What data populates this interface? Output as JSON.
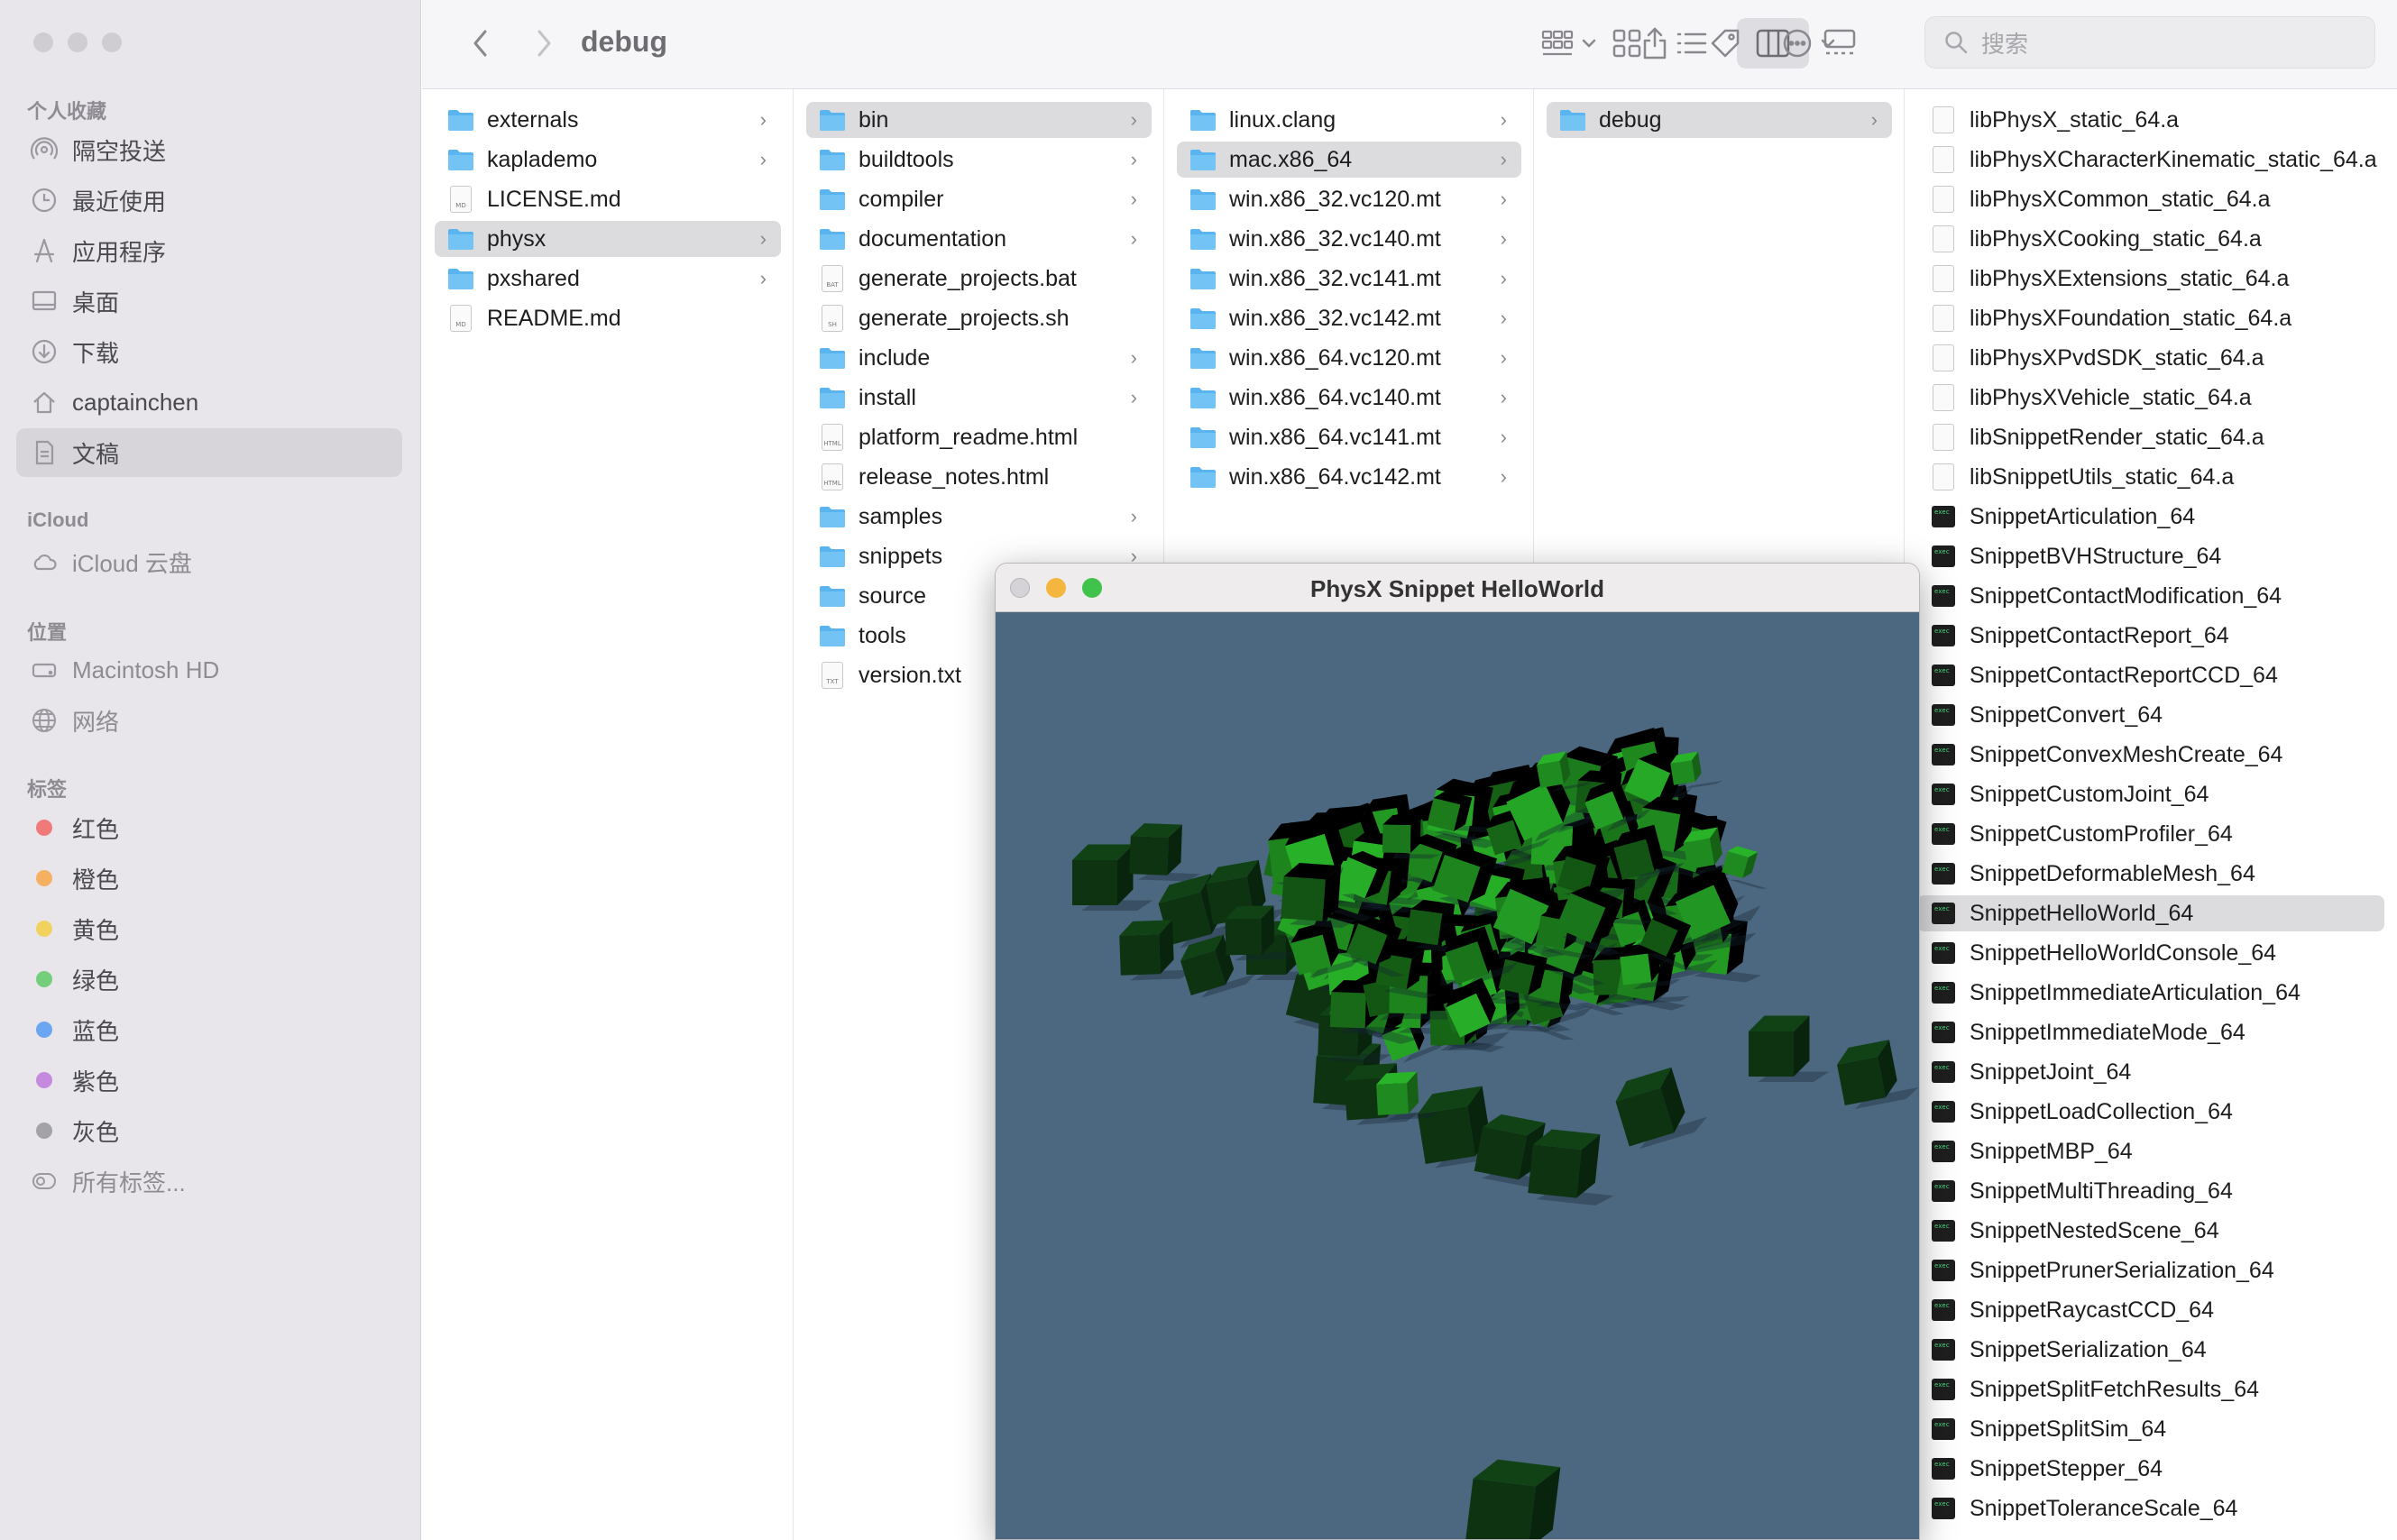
{
  "sidebar": {
    "favorites_header": "个人收藏",
    "favorites": [
      {
        "label": "隔空投送",
        "icon": "airdrop-icon"
      },
      {
        "label": "最近使用",
        "icon": "clock-icon"
      },
      {
        "label": "应用程序",
        "icon": "applications-icon"
      },
      {
        "label": "桌面",
        "icon": "desktop-icon"
      },
      {
        "label": "下载",
        "icon": "download-icon"
      },
      {
        "label": "captainchen",
        "icon": "home-icon"
      },
      {
        "label": "文稿",
        "icon": "document-icon"
      }
    ],
    "selected_favorite": "文稿",
    "icloud_header": "iCloud",
    "icloud": [
      {
        "label": "iCloud 云盘",
        "icon": "cloud-icon"
      }
    ],
    "locations_header": "位置",
    "locations": [
      {
        "label": "Macintosh HD",
        "icon": "disk-icon"
      },
      {
        "label": "网络",
        "icon": "globe-icon"
      }
    ],
    "tags_header": "标签",
    "tags": [
      {
        "label": "红色",
        "color": "#f07a7a"
      },
      {
        "label": "橙色",
        "color": "#f5b061"
      },
      {
        "label": "黄色",
        "color": "#f2d25f"
      },
      {
        "label": "绿色",
        "color": "#74cf7a"
      },
      {
        "label": "蓝色",
        "color": "#6aa6f2"
      },
      {
        "label": "紫色",
        "color": "#c58ae0"
      },
      {
        "label": "灰色",
        "color": "#a3a3a7"
      }
    ],
    "all_tags": "所有标签..."
  },
  "toolbar": {
    "title": "debug",
    "search_placeholder": "搜索",
    "active_view": "columns"
  },
  "columns": [
    {
      "items": [
        {
          "name": "externals",
          "type": "folder",
          "chevron": true
        },
        {
          "name": "kaplademo",
          "type": "folder",
          "chevron": true
        },
        {
          "name": "LICENSE.md",
          "type": "doc",
          "badge": "MD"
        },
        {
          "name": "physx",
          "type": "folder",
          "chevron": true,
          "selected": true
        },
        {
          "name": "pxshared",
          "type": "folder",
          "chevron": true
        },
        {
          "name": "README.md",
          "type": "doc",
          "badge": "MD"
        }
      ]
    },
    {
      "items": [
        {
          "name": "bin",
          "type": "folder",
          "chevron": true,
          "selected": true
        },
        {
          "name": "buildtools",
          "type": "folder",
          "chevron": true
        },
        {
          "name": "compiler",
          "type": "folder",
          "chevron": true
        },
        {
          "name": "documentation",
          "type": "folder",
          "chevron": true
        },
        {
          "name": "generate_projects.bat",
          "type": "doc",
          "badge": "BAT"
        },
        {
          "name": "generate_projects.sh",
          "type": "doc",
          "badge": "SH"
        },
        {
          "name": "include",
          "type": "folder",
          "chevron": true
        },
        {
          "name": "install",
          "type": "folder",
          "chevron": true
        },
        {
          "name": "platform_readme.html",
          "type": "doc",
          "badge": "HTML"
        },
        {
          "name": "release_notes.html",
          "type": "doc",
          "badge": "HTML"
        },
        {
          "name": "samples",
          "type": "folder",
          "chevron": true
        },
        {
          "name": "snippets",
          "type": "folder",
          "chevron": true
        },
        {
          "name": "source",
          "type": "folder",
          "chevron": true
        },
        {
          "name": "tools",
          "type": "folder",
          "chevron": true
        },
        {
          "name": "version.txt",
          "type": "doc",
          "badge": "TXT"
        }
      ]
    },
    {
      "items": [
        {
          "name": "linux.clang",
          "type": "folder",
          "chevron": true
        },
        {
          "name": "mac.x86_64",
          "type": "folder",
          "chevron": true,
          "selected": true
        },
        {
          "name": "win.x86_32.vc120.mt",
          "type": "folder",
          "chevron": true
        },
        {
          "name": "win.x86_32.vc140.mt",
          "type": "folder",
          "chevron": true
        },
        {
          "name": "win.x86_32.vc141.mt",
          "type": "folder",
          "chevron": true
        },
        {
          "name": "win.x86_32.vc142.mt",
          "type": "folder",
          "chevron": true
        },
        {
          "name": "win.x86_64.vc120.mt",
          "type": "folder",
          "chevron": true
        },
        {
          "name": "win.x86_64.vc140.mt",
          "type": "folder",
          "chevron": true
        },
        {
          "name": "win.x86_64.vc141.mt",
          "type": "folder",
          "chevron": true
        },
        {
          "name": "win.x86_64.vc142.mt",
          "type": "folder",
          "chevron": true
        }
      ]
    },
    {
      "items": [
        {
          "name": "debug",
          "type": "folder",
          "chevron": true,
          "selected": true
        }
      ]
    },
    {
      "items": [
        {
          "name": "libPhysX_static_64.a",
          "type": "doc",
          "badge": ""
        },
        {
          "name": "libPhysXCharacterKinematic_static_64.a",
          "type": "doc",
          "badge": ""
        },
        {
          "name": "libPhysXCommon_static_64.a",
          "type": "doc",
          "badge": ""
        },
        {
          "name": "libPhysXCooking_static_64.a",
          "type": "doc",
          "badge": ""
        },
        {
          "name": "libPhysXExtensions_static_64.a",
          "type": "doc",
          "badge": ""
        },
        {
          "name": "libPhysXFoundation_static_64.a",
          "type": "doc",
          "badge": ""
        },
        {
          "name": "libPhysXPvdSDK_static_64.a",
          "type": "doc",
          "badge": ""
        },
        {
          "name": "libPhysXVehicle_static_64.a",
          "type": "doc",
          "badge": ""
        },
        {
          "name": "libSnippetRender_static_64.a",
          "type": "doc",
          "badge": ""
        },
        {
          "name": "libSnippetUtils_static_64.a",
          "type": "doc",
          "badge": ""
        },
        {
          "name": "SnippetArticulation_64",
          "type": "exec"
        },
        {
          "name": "SnippetBVHStructure_64",
          "type": "exec"
        },
        {
          "name": "SnippetContactModification_64",
          "type": "exec"
        },
        {
          "name": "SnippetContactReport_64",
          "type": "exec"
        },
        {
          "name": "SnippetContactReportCCD_64",
          "type": "exec"
        },
        {
          "name": "SnippetConvert_64",
          "type": "exec"
        },
        {
          "name": "SnippetConvexMeshCreate_64",
          "type": "exec"
        },
        {
          "name": "SnippetCustomJoint_64",
          "type": "exec"
        },
        {
          "name": "SnippetCustomProfiler_64",
          "type": "exec"
        },
        {
          "name": "SnippetDeformableMesh_64",
          "type": "exec"
        },
        {
          "name": "SnippetHelloWorld_64",
          "type": "exec",
          "selected": true
        },
        {
          "name": "SnippetHelloWorldConsole_64",
          "type": "exec"
        },
        {
          "name": "SnippetImmediateArticulation_64",
          "type": "exec"
        },
        {
          "name": "SnippetImmediateMode_64",
          "type": "exec"
        },
        {
          "name": "SnippetJoint_64",
          "type": "exec"
        },
        {
          "name": "SnippetLoadCollection_64",
          "type": "exec"
        },
        {
          "name": "SnippetMBP_64",
          "type": "exec"
        },
        {
          "name": "SnippetMultiThreading_64",
          "type": "exec"
        },
        {
          "name": "SnippetNestedScene_64",
          "type": "exec"
        },
        {
          "name": "SnippetPrunerSerialization_64",
          "type": "exec"
        },
        {
          "name": "SnippetRaycastCCD_64",
          "type": "exec"
        },
        {
          "name": "SnippetSerialization_64",
          "type": "exec"
        },
        {
          "name": "SnippetSplitFetchResults_64",
          "type": "exec"
        },
        {
          "name": "SnippetSplitSim_64",
          "type": "exec"
        },
        {
          "name": "SnippetStepper_64",
          "type": "exec"
        },
        {
          "name": "SnippetToleranceScale_64",
          "type": "exec"
        }
      ]
    }
  ],
  "physx_window": {
    "title": "PhysX Snippet HelloWorld",
    "background": "#4c6880",
    "cube_color": "#1f8a1f",
    "resting_cube_color": "#0d3311"
  }
}
